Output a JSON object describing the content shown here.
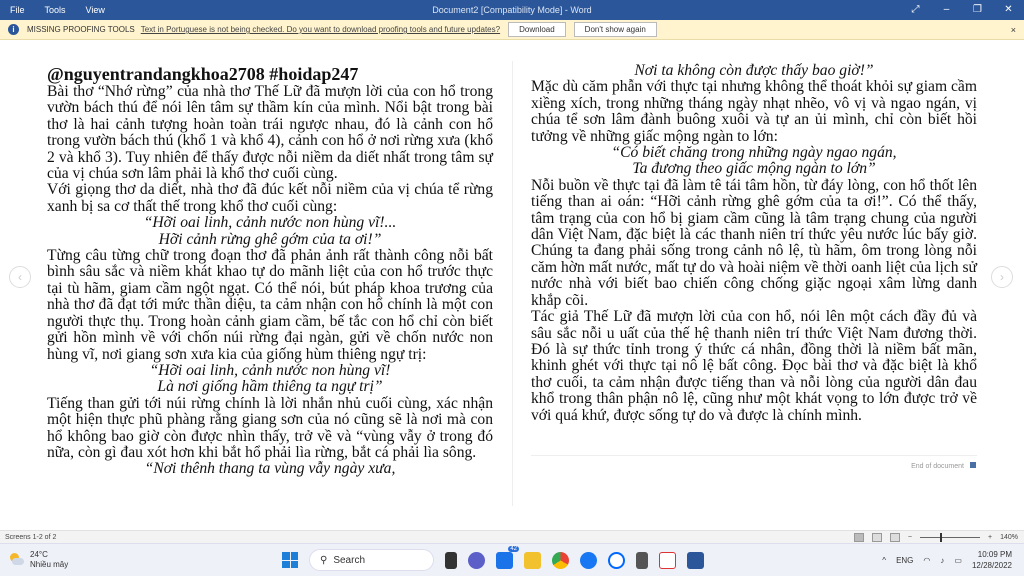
{
  "titlebar": {
    "menus": [
      "File",
      "Tools",
      "View"
    ],
    "title": "Document2 [Compatibility Mode]  -  Word"
  },
  "infobar": {
    "label": "MISSING PROOFING TOOLS",
    "message": "Text in Portuguese is not being checked. Do you want to download proofing tools and future updates?",
    "download": "Download",
    "dont_show": "Don't show again",
    "close": "×"
  },
  "left_column": {
    "heading": "@nguyentrandangkhoa2708 #hoidap247",
    "p1": "Bài thơ “Nhớ rừng” của nhà thơ Thế Lữ đã mượn lời của con hổ trong vườn bách thú để nói lên tâm sự thầm kín của mình. Nổi bật trong bài thơ là hai cảnh tượng hoàn toàn trái ngược nhau, đó là cảnh con hổ trong vườn bách thú (khổ 1 và khổ 4), cảnh con hổ ở nơi rừng xưa (khổ 2 và khổ 3). Tuy nhiên để thấy được nỗi niềm da diết nhất trong tâm sự của vị chúa sơn lâm phải là khổ thơ cuối cùng.",
    "p2": "Với giọng thơ da diết, nhà thơ đã đúc kết nỗi niềm của vị chúa tể rừng xanh bị sa cơ thất thế trong khổ thơ cuối cùng:",
    "poem1": [
      "“Hỡi oai linh, cảnh nước non hùng vĩ!...",
      "Hỡi cảnh rừng ghê gớm của ta ơi!”"
    ],
    "p3": "Từng câu từng chữ trong đoạn thơ đã phản ảnh rất thành công nỗi bất bình sâu sắc và niềm khát khao tự do mãnh liệt của con hổ trước thực tại tù hãm, giam cầm ngột ngạt. Có thể nói, bút pháp khoa trương của nhà thơ đã đạt tới mức thần diệu, ta cảm nhận con hổ chính là một con người thực thụ. Trong hoàn cảnh giam cầm, bế tắc con hổ chỉ còn biết gửi hồn mình về với chốn núi rừng đại ngàn, gửi về chốn nước non hùng vĩ, nơi giang sơn xưa kia của giống hùm thiêng ngự trị:",
    "poem2": [
      "“Hỡi oai linh, cảnh nước non hùng vĩ!",
      "Là nơi giống hầm thiêng ta ngự trị”"
    ],
    "p4": "Tiếng than gửi tới núi rừng chính là lời nhắn nhủ cuối cùng, xác nhận một hiện thực phũ phàng rằng giang sơn của nó cũng sẽ là nơi mà con hổ không bao giờ còn được nhìn thấy, trở về và “vùng vẫy ở trong đó nữa, còn gì đau xót hơn khi bắt hổ phải lìa rừng, bắt cá phải lìa sông.",
    "poem3": "“Nơi thênh thang ta vùng vẫy ngày xưa,"
  },
  "right_column": {
    "poem3b": "Nơi ta không còn được thấy bao giờ!”",
    "p5": "Mặc dù căm phẫn với thực tại nhưng không thể thoát khỏi sự giam cầm xiềng xích, trong những tháng ngày nhạt nhẽo, vô vị và ngao ngán, vị chúa tể sơn lâm đành buông xuôi và tự an ủi mình, chỉ còn biết hồi tưởng về những giấc mộng ngàn to lớn:",
    "poem4": [
      "“Có biết chăng trong những ngày ngao ngán,",
      "Ta đương theo giấc mộng ngàn to lớn”"
    ],
    "p6": "Nỗi buồn về thực tại đã làm tê tái tâm hồn, từ đáy lòng, con hổ thốt lên tiếng than ai oán: “Hỡi cảnh rừng ghê gớm của ta ơi!”. Có thể thấy, tâm trạng của con hổ bị giam cầm cũng là tâm trạng chung của người dân Việt Nam, đặc biệt là các thanh niên trí thức yêu nước lúc bấy giờ. Chúng ta đang phải sống trong cảnh nô lệ, tù hãm, ôm trong lòng nỗi căm hờn mất nước, mất tự do và hoài niệm về thời oanh liệt của lịch sử nước nhà với biết bao chiến công chống giặc ngoại xâm lừng danh khắp cõi.",
    "p7": "Tác giả Thế Lữ đã mượn lời của con hổ, nói lên một cách đầy đủ và sâu sắc nỗi u uất của thế hệ thanh niên trí thức Việt Nam đương thời. Đó là sự thức tỉnh trong ý thức cá nhân, đồng thời là niềm bất mãn, khinh ghét với thực tại nô lệ bất công. Đọc bài thơ và đặc biệt là khổ thơ cuối, ta cảm nhận được tiếng than và nỗi lòng của người dân đau khổ trong thân phận nô lệ, cũng như một khát vọng to lớn được trở về với quá khứ, được sống tự do và được là chính mình.",
    "end": "End of document"
  },
  "status": {
    "screens": "Screens 1-2 of 2",
    "zoom": "140%"
  },
  "taskbar": {
    "temp": "24°C",
    "weather": "Nhiều mây",
    "search": "Search",
    "badge": "42",
    "lang": "ENG",
    "time": "10:09 PM",
    "date": "12/28/2022"
  }
}
